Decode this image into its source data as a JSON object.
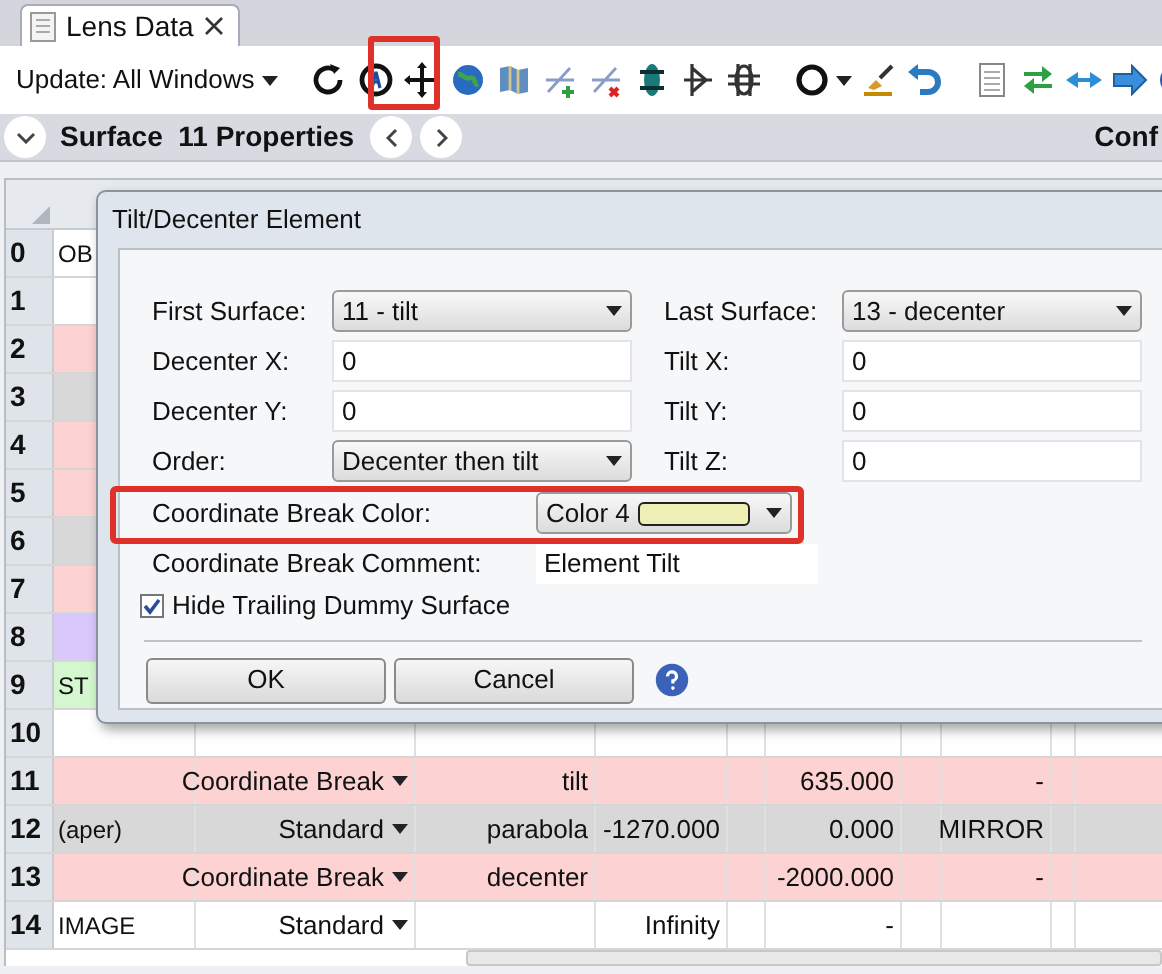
{
  "tab": {
    "label": "Lens Data"
  },
  "toolbar": {
    "update_menu": "Update: All Windows"
  },
  "surface_bar": {
    "title": "Surface  11 Properties",
    "right_label": "Conf"
  },
  "table": {
    "rows": [
      {
        "number": "0",
        "color": "#ffffff",
        "comment": "OB"
      },
      {
        "number": "1",
        "color": "#ffffff"
      },
      {
        "number": "2",
        "color": "#fcd2d2"
      },
      {
        "number": "3",
        "color": "#d8d8d8"
      },
      {
        "number": "4",
        "color": "#fcd2d2"
      },
      {
        "number": "5",
        "color": "#fcd2d2"
      },
      {
        "number": "6",
        "color": "#d8d8d8"
      },
      {
        "number": "7",
        "color": "#fcd2d2"
      },
      {
        "number": "8",
        "color": "#d9c8fa"
      },
      {
        "number": "9",
        "color": "#d4f7cf",
        "comment": "ST"
      },
      {
        "number": "10",
        "color": "#ffffff"
      },
      {
        "number": "11",
        "color": "#fcd2d2",
        "surface_type": "Coordinate Break",
        "column_3": "tilt",
        "column_6": "635.000",
        "column_8": "-"
      },
      {
        "number": "12",
        "color": "#d8d8d8",
        "comment": "(aper)",
        "surface_type": "Standard",
        "column_3": "parabola",
        "column_4": "-1270.000",
        "column_6": "0.000",
        "column_8": "MIRROR"
      },
      {
        "number": "13",
        "color": "#fcd2d2",
        "surface_type": "Coordinate Break",
        "column_3": "decenter",
        "column_6": "-2000.000",
        "column_8": "-"
      },
      {
        "number": "14",
        "color": "#ffffff",
        "comment": "IMAGE",
        "surface_type": "Standard",
        "column_4": "Infinity",
        "column_6": "-"
      }
    ]
  },
  "dialog": {
    "title": "Tilt/Decenter Element",
    "left_fields": [
      {
        "kind": "dropdown",
        "label": "First Surface:",
        "value": "11 - tilt"
      },
      {
        "kind": "text",
        "label": "Decenter X:",
        "value": "0"
      },
      {
        "kind": "text",
        "label": "Decenter Y:",
        "value": "0"
      },
      {
        "kind": "dropdown",
        "label": "Order:",
        "value": "Decenter then tilt"
      }
    ],
    "right_fields": [
      {
        "kind": "dropdown",
        "label": "Last Surface:",
        "value": "13 - decenter"
      },
      {
        "kind": "text",
        "label": "Tilt X:",
        "value": "0"
      },
      {
        "kind": "text",
        "label": "Tilt Y:",
        "value": "0"
      },
      {
        "kind": "text",
        "label": "Tilt Z:",
        "value": "0"
      }
    ],
    "color_field": {
      "label": "Coordinate Break Color:",
      "value": "Color 4",
      "color": "#eeefb4"
    },
    "comment_field": {
      "label": "Coordinate Break Comment:",
      "value": "Element Tilt"
    },
    "checkbox": {
      "label": "Hide Trailing Dummy Surface",
      "checked": true
    },
    "buttons": [
      "OK",
      "Cancel"
    ]
  }
}
